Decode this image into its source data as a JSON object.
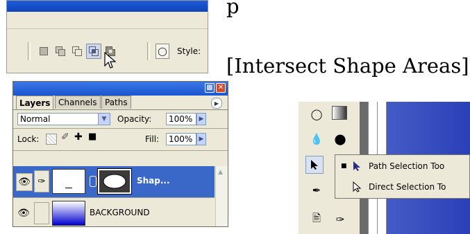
{
  "caption": {
    "top_text": "p",
    "intersect_label": "[Intersect Shape Areas]"
  },
  "options_bar": {
    "style_label": "Style:",
    "modes": [
      {
        "name": "new-layer",
        "pressed": false
      },
      {
        "name": "add-to-shape-area",
        "pressed": false
      },
      {
        "name": "subtract-from-shape-area",
        "pressed": false
      },
      {
        "name": "intersect-shape-areas",
        "pressed": true
      },
      {
        "name": "exclude-overlapping-shape-areas",
        "pressed": false
      }
    ]
  },
  "layers_panel": {
    "tabs": [
      "Layers",
      "Channels",
      "Paths"
    ],
    "active_tab": "Layers",
    "blend_mode": "Normal",
    "opacity_label": "Opacity:",
    "opacity_value": "100%",
    "lock_label": "Lock:",
    "fill_label": "Fill:",
    "fill_value": "100%",
    "layers": [
      {
        "name": "Shap...",
        "selected": true
      },
      {
        "name": "BACKGROUND",
        "selected": false
      }
    ]
  },
  "tools_flyout": {
    "items": [
      {
        "label": "Path Selection Too",
        "checked": true
      },
      {
        "label": "Direct Selection To",
        "checked": false
      }
    ]
  },
  "colors": {
    "ui_bg": "#ece9d8",
    "xp_blue": "#1b55d0",
    "selection_blue": "#3264c8",
    "gradient_top": "#ffffff",
    "gradient_bottom": "#0000d0"
  }
}
